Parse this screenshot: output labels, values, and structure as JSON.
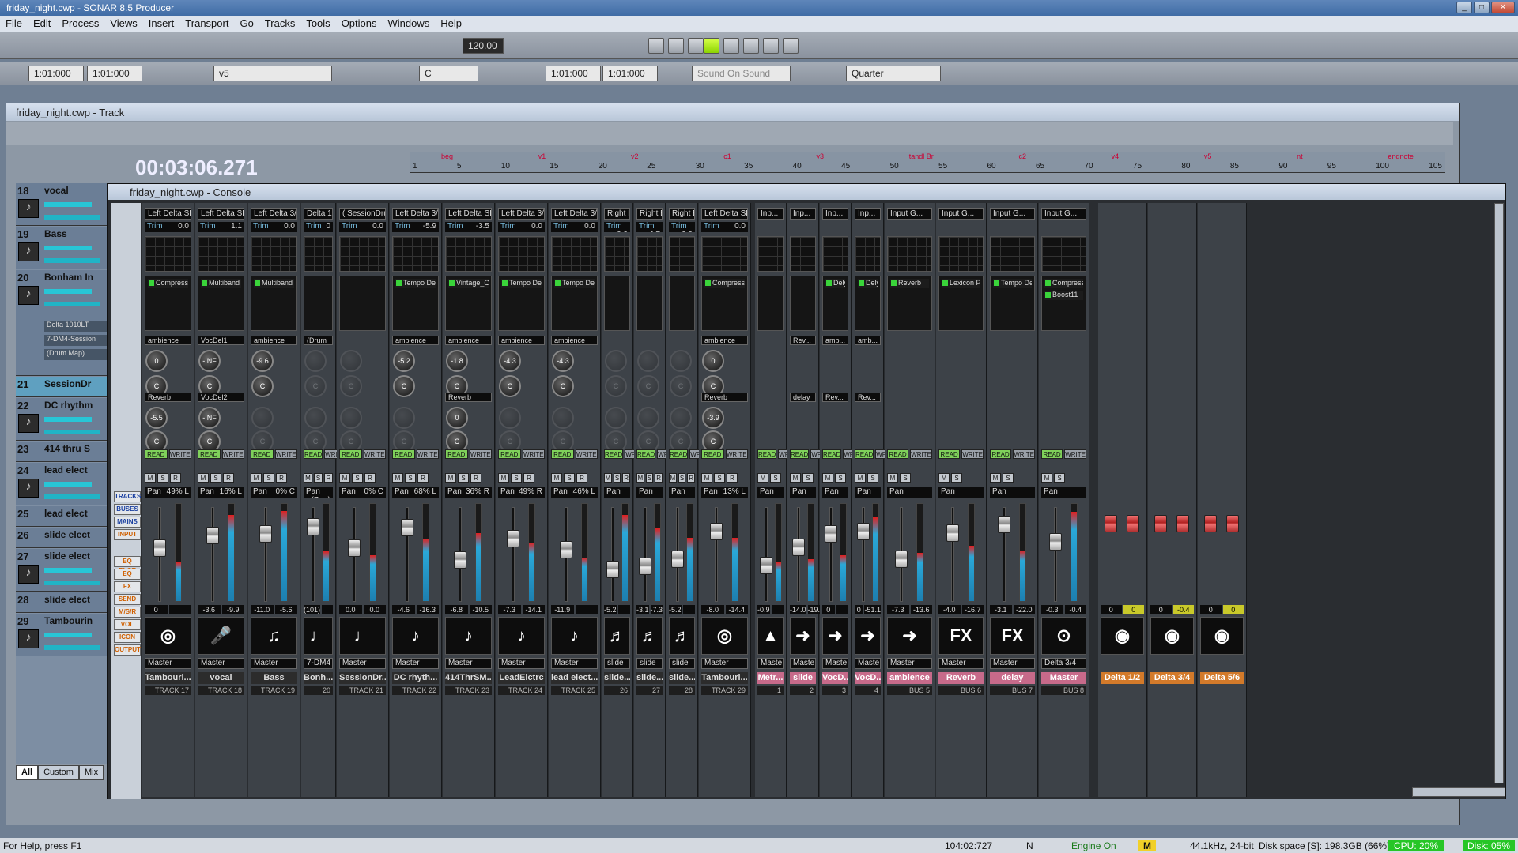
{
  "app": {
    "title": "friday_night.cwp - SONAR 8.5 Producer",
    "menu": [
      "File",
      "Edit",
      "Process",
      "Views",
      "Insert",
      "Transport",
      "Go",
      "Tracks",
      "Tools",
      "Options",
      "Windows",
      "Help"
    ]
  },
  "toolbar": {
    "tempo": "120.00",
    "time_a": "1:01:000",
    "time_b": "1:01:000",
    "preset": "v5",
    "key": "C",
    "loop_start": "1:01:000",
    "loop_end": "1:01:000",
    "sound_on_sound": "Sound On Sound",
    "snap": "Quarter"
  },
  "track_window": {
    "title": "friday_night.cwp - Track",
    "timecode": "00:03:06.271",
    "ruler_numbers": [
      "1",
      "5",
      "10",
      "15",
      "20",
      "25",
      "30",
      "35",
      "40",
      "45",
      "50",
      "55",
      "60",
      "65",
      "70",
      "75",
      "80",
      "85",
      "90",
      "95",
      "100",
      "105"
    ],
    "ruler_markers": [
      "beg",
      "v1",
      "v2",
      "c1",
      "v3",
      "tandl Br",
      "c2",
      "v4",
      "v5",
      "nt",
      "endnote"
    ],
    "tracks": [
      {
        "num": "18",
        "name": "vocal"
      },
      {
        "num": "19",
        "name": "Bass"
      },
      {
        "num": "20",
        "name": "Bonham In"
      },
      {
        "num": "21",
        "name": "SessionDr"
      },
      {
        "num": "22",
        "name": "DC rhythm"
      },
      {
        "num": "23",
        "name": "414 thru S"
      },
      {
        "num": "24",
        "name": "lead elect"
      },
      {
        "num": "25",
        "name": "lead elect"
      },
      {
        "num": "26",
        "name": "slide elect"
      },
      {
        "num": "27",
        "name": "slide elect"
      },
      {
        "num": "28",
        "name": "slide elect"
      },
      {
        "num": "29",
        "name": "Tambourin"
      }
    ],
    "bonham_sub": [
      "Delta 1010LT",
      "7-DM4-Session",
      "(Drum Map)"
    ],
    "tabs": [
      "All",
      "Custom",
      "Mix"
    ]
  },
  "console": {
    "title": "friday_night.cwp - Console",
    "left_buttons": [
      "TRACKS",
      "BUSES",
      "MAINS",
      "INPUT",
      "EQ PLOT",
      "EQ",
      "FX",
      "SEND",
      "M/S/R",
      "VOL",
      "ICON",
      "OUTPUT"
    ],
    "strips": [
      {
        "in": "Left Delta SPI",
        "trim": "0.0",
        "fx": [
          "Compressor"
        ],
        "send1": "ambience",
        "k1": "0",
        "send2": "Reverb",
        "k2": "-5.5",
        "pan": "49% L",
        "v1": "0",
        "v2": "",
        "img": "tamb",
        "out": "Master",
        "name": "Tambouri...",
        "num": "TRACK 17"
      },
      {
        "in": "Left Delta SPI",
        "trim": "1.1",
        "fx": [
          "Multiband"
        ],
        "send1": "VocDel1",
        "k1": "-INF",
        "send2": "VocDel2",
        "k2": "-INF",
        "pan": "16% L",
        "v1": "-3.6",
        "v2": "-9.9",
        "img": "mic",
        "out": "Master",
        "name": "vocal",
        "num": "TRACK 18"
      },
      {
        "in": "Left Delta 3/4",
        "trim": "0.0",
        "fx": [
          "Multiband"
        ],
        "send1": "ambience",
        "k1": "-9.6",
        "send2": "",
        "k2": "",
        "pan": "0% C",
        "v1": "-11.0",
        "v2": "-5.6",
        "img": "bass",
        "out": "Master",
        "name": "Bass",
        "num": "TRACK 19"
      },
      {
        "in": "Delta 1",
        "trim": "0",
        "fx": [],
        "send1": "(Drum",
        "k1": "",
        "send2": "",
        "k2": "",
        "pan": "(Pan)",
        "v1": "(101)",
        "v2": "",
        "img": "drum",
        "out": "7-DM4",
        "name": "Bonh...",
        "num": "20"
      },
      {
        "in": "( SessionDrum",
        "trim": "0.0",
        "fx": [],
        "send1": "",
        "k1": "",
        "send2": "",
        "k2": "",
        "pan": "0% C",
        "v1": "0.0",
        "v2": "0.0",
        "img": "drum",
        "out": "Master",
        "name": "SessionDr...",
        "num": "TRACK 21"
      },
      {
        "in": "Left Delta 3/4",
        "trim": "-5.9",
        "fx": [
          "Tempo De..."
        ],
        "send1": "ambience",
        "k1": "-5.2",
        "send2": "",
        "k2": "",
        "pan": "68% L",
        "v1": "-4.6",
        "v2": "-16.3",
        "img": "guit",
        "out": "Master",
        "name": "DC rhyth...",
        "num": "TRACK 22"
      },
      {
        "in": "Left Delta SPI",
        "trim": "-3.5",
        "fx": [
          "Vintage_C..."
        ],
        "send1": "ambience",
        "k1": "-1.8",
        "send2": "Reverb",
        "k2": "0",
        "pan": "36% R",
        "v1": "-6.8",
        "v2": "-10.5",
        "img": "guit",
        "out": "Master",
        "name": "414ThrSM...",
        "num": "TRACK 23"
      },
      {
        "in": "Left Delta 3/4",
        "trim": "0.0",
        "fx": [
          "Tempo De..."
        ],
        "send1": "ambience",
        "k1": "-4.3",
        "send2": "",
        "k2": "",
        "pan": "49% R",
        "v1": "-7.3",
        "v2": "-14.1",
        "img": "guit",
        "out": "Master",
        "name": "LeadElctrc",
        "num": "TRACK 24"
      },
      {
        "in": "Left Delta 3/4",
        "trim": "0.0",
        "fx": [
          "Tempo De..."
        ],
        "send1": "ambience",
        "k1": "-4.3",
        "send2": "",
        "k2": "",
        "pan": "46% L",
        "v1": "-11.9",
        "v2": "",
        "img": "guit",
        "out": "Master",
        "name": "lead elect...",
        "num": "TRACK 25"
      },
      {
        "in": "Right E",
        "trim": "0.0",
        "fx": [],
        "send1": "",
        "k1": "",
        "send2": "",
        "k2": "",
        "pan": "",
        "v1": "-5.2",
        "v2": "",
        "img": "elec",
        "out": "slide",
        "name": "slide...",
        "num": "26"
      },
      {
        "in": "Right E",
        "trim": "4.7",
        "fx": [],
        "send1": "",
        "k1": "",
        "send2": "",
        "k2": "",
        "pan": "",
        "v1": "-3.1",
        "v2": "-7.3",
        "img": "elec",
        "out": "slide",
        "name": "slide...",
        "num": "27"
      },
      {
        "in": "Right E",
        "trim": "0.0",
        "fx": [],
        "send1": "",
        "k1": "",
        "send2": "",
        "k2": "",
        "pan": "",
        "v1": "-5.2",
        "v2": "",
        "img": "elec",
        "out": "slide",
        "name": "slide...",
        "num": "28"
      },
      {
        "in": "Left Delta SPI",
        "trim": "0.0",
        "fx": [
          "Compressor"
        ],
        "send1": "ambience",
        "k1": "0",
        "send2": "Reverb",
        "k2": "-3.9",
        "pan": "13% L",
        "v1": "-8.0",
        "v2": "-14.4",
        "img": "tamb",
        "out": "Master",
        "name": "Tambouri...",
        "num": "TRACK 29"
      }
    ],
    "buses": [
      {
        "in": "Inp...",
        "fx": [],
        "send1": "",
        "send2": "",
        "v1": "-0.9",
        "v2": "",
        "img": "metro",
        "out": "Maste",
        "name": "Metr...",
        "num": "1",
        "cls": "pink"
      },
      {
        "in": "Inp...",
        "fx": [],
        "send1": "Rev...",
        "send2": "delay",
        "v1": "-14.0",
        "v2": "-19.5",
        "img": "arrow",
        "out": "Maste",
        "name": "slide",
        "num": "2",
        "cls": "pink"
      },
      {
        "in": "Inp...",
        "fx": [
          "Dely"
        ],
        "send1": "amb...",
        "send2": "Rev...",
        "v1": "0",
        "v2": "",
        "img": "arrow",
        "out": "Maste",
        "name": "VocD...",
        "num": "3",
        "cls": "pink"
      },
      {
        "in": "Inp...",
        "fx": [
          "Dely"
        ],
        "send1": "amb...",
        "send2": "Rev...",
        "v1": "0",
        "v2": "-51.1",
        "img": "arrow",
        "out": "Maste",
        "name": "VocD...",
        "num": "4",
        "cls": "pink"
      },
      {
        "in": "Input G...",
        "fx": [
          "Reverb"
        ],
        "send1": "",
        "send2": "",
        "v1": "-7.3",
        "v2": "-13.6",
        "img": "arrowbig",
        "out": "Master",
        "name": "ambience",
        "num": "BUS 5",
        "cls": "pink"
      },
      {
        "in": "Input G...",
        "fx": [
          "Lexicon Pa..."
        ],
        "send1": "",
        "send2": "",
        "v1": "-4.0",
        "v2": "-16.7",
        "img": "FX",
        "out": "Master",
        "name": "Reverb",
        "num": "BUS 6",
        "cls": "pink"
      },
      {
        "in": "Input G...",
        "fx": [
          "Tempo De..."
        ],
        "send1": "",
        "send2": "",
        "v1": "-3.1",
        "v2": "-22.0",
        "img": "FX",
        "out": "Master",
        "name": "delay",
        "num": "BUS 7",
        "cls": "pink"
      },
      {
        "in": "Input G...",
        "fx": [
          "Compressor",
          "Boost11"
        ],
        "send1": "",
        "send2": "",
        "v1": "-0.3",
        "v2": "-0.4",
        "img": "target",
        "out": "Delta 3/4",
        "name": "Master",
        "num": "BUS 8",
        "cls": "pink"
      }
    ],
    "mains": [
      {
        "name": "Delta 1/2",
        "v1": "0",
        "v2": "0"
      },
      {
        "name": "Delta 3/4",
        "v1": "0",
        "v2": "-0.4"
      },
      {
        "name": "Delta 5/6",
        "v1": "0",
        "v2": "0"
      }
    ],
    "labels": {
      "read": "READ",
      "write": "WRITE",
      "m": "M",
      "s": "S",
      "r": "R",
      "pan": "Pan",
      "trim": "Trim",
      "post": "POST"
    }
  },
  "status": {
    "help": "For Help, press F1",
    "position": "104:02:727",
    "n": "N",
    "engine": "Engine On",
    "m": "M",
    "format": "44.1kHz, 24-bit",
    "disk": "Disk space [S]: 198.3GB (66%)",
    "cpu": "CPU: 20%",
    "disk_pct": "Disk: 05%"
  }
}
